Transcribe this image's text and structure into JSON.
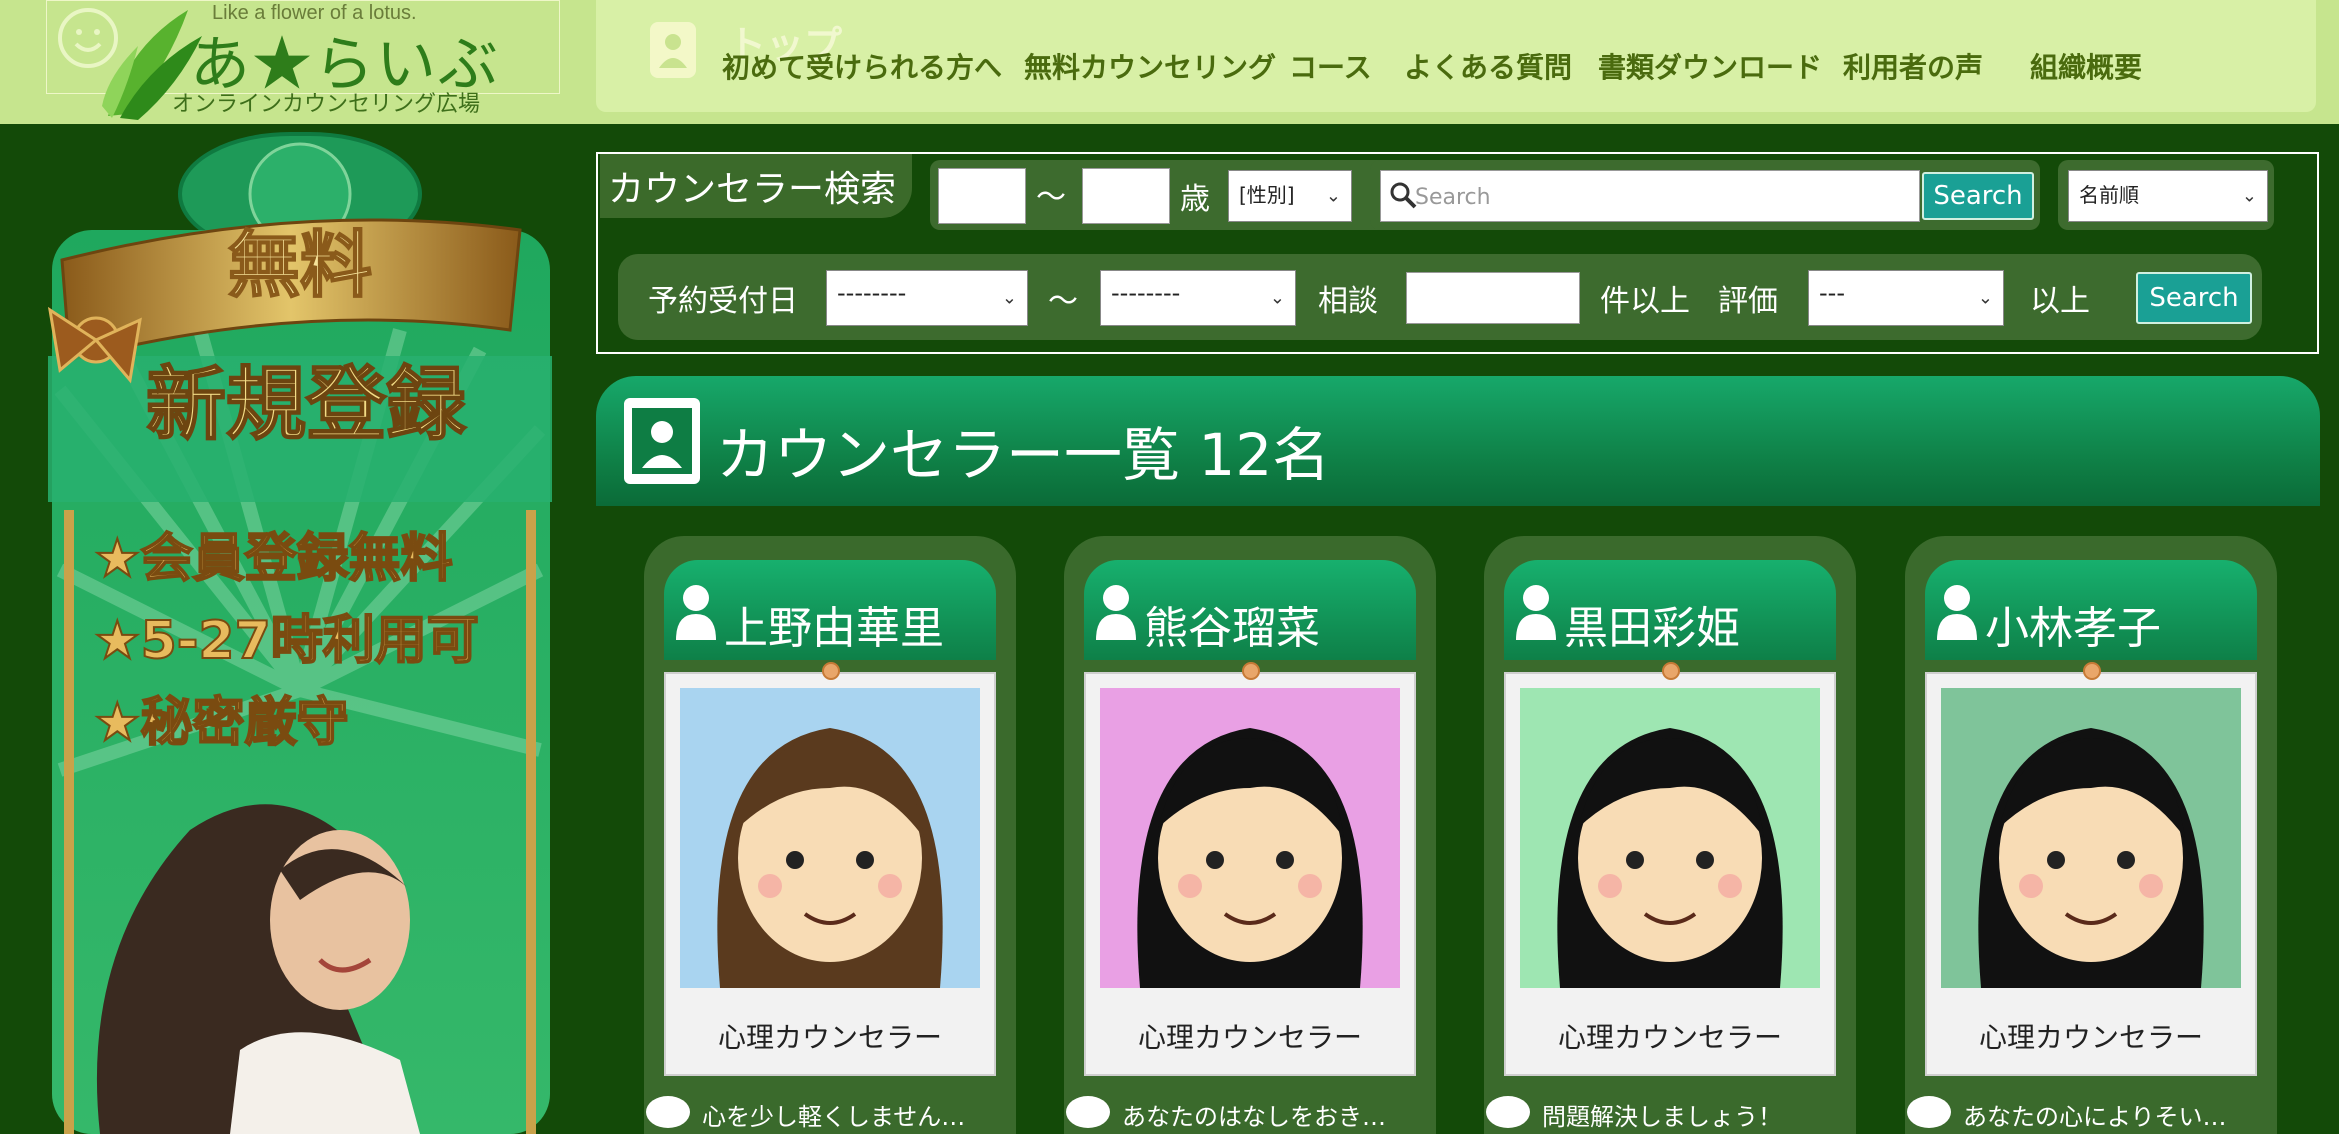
{
  "header": {
    "logo_tagline": "Like a flower of a lotus.",
    "logo_name": "あ★らいぶ",
    "logo_sub": "オンラインカウンセリング広場",
    "top_label": "トップ",
    "nav": [
      "初めて受けられる方へ",
      "無料カウンセリング",
      "コース",
      "よくある質問",
      "書類ダウンロード",
      "利用者の声",
      "組織概要"
    ]
  },
  "banner": {
    "free": "無料",
    "register": "新規登録",
    "points": [
      "★会員登録無料",
      "★5-27時利用可",
      "★秘密厳守"
    ]
  },
  "search": {
    "title": "カウンセラー検索",
    "tilde": "～",
    "age_unit": "歳",
    "gender_select": "[性別]",
    "search_placeholder": "Search",
    "search_button": "Search",
    "sort_select": "名前順",
    "date_label": "予約受付日",
    "date_from": "--------",
    "date_to": "--------",
    "consult_label": "相談",
    "count_suffix": "件以上",
    "rating_label": "評価",
    "rating_select": "---",
    "rating_suffix": "以上",
    "search_button_2": "Search"
  },
  "list": {
    "title": "カウンセラー一覧 12名"
  },
  "counselors": [
    {
      "name": "上野由華里",
      "role": "心理カウンセラー",
      "message": "心を少し軽くしません…",
      "bg": "#a9d4f0"
    },
    {
      "name": "熊谷瑠菜",
      "role": "心理カウンセラー",
      "message": "あなたのはなしをおき…",
      "bg": "#e9a0e4"
    },
    {
      "name": "黒田彩姫",
      "role": "心理カウンセラー",
      "message": "問題解決しましょう！",
      "bg": "#9ee6b2"
    },
    {
      "name": "小林孝子",
      "role": "心理カウンセラー",
      "message": "あなたの心によりそい…",
      "bg": "#7fc49a"
    }
  ]
}
